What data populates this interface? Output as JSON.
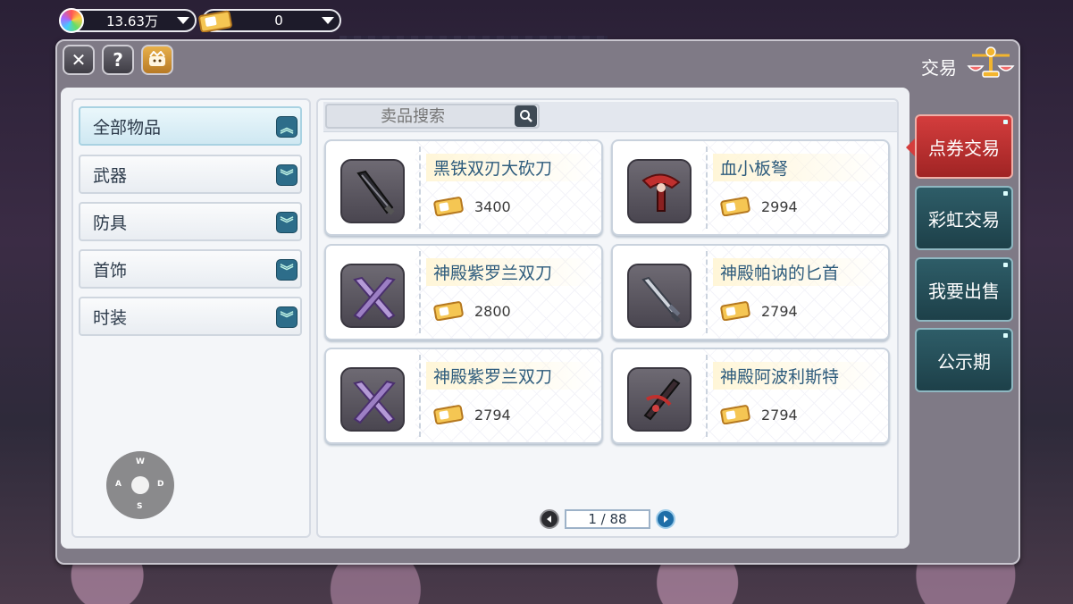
{
  "currency": {
    "rainbow_value": "13.63万",
    "ticket_value": "0"
  },
  "window": {
    "title": "交易"
  },
  "search": {
    "placeholder": "卖品搜索"
  },
  "categories": [
    {
      "label": "全部物品",
      "expanded": true
    },
    {
      "label": "武器",
      "expanded": false
    },
    {
      "label": "防具",
      "expanded": false
    },
    {
      "label": "首饰",
      "expanded": false
    },
    {
      "label": "时装",
      "expanded": false
    }
  ],
  "items": [
    {
      "name": "黑铁双刃大砍刀",
      "price": "3400"
    },
    {
      "name": "血小板弩",
      "price": "2994"
    },
    {
      "name": "神殿紫罗兰双刀",
      "price": "2800"
    },
    {
      "name": "神殿帕讷的匕首",
      "price": "2794"
    },
    {
      "name": "神殿紫罗兰双刀",
      "price": "2794"
    },
    {
      "name": "神殿阿波利斯特",
      "price": "2794"
    }
  ],
  "pager": {
    "current": 1,
    "total": 88,
    "text": "1 / 88"
  },
  "side_tabs": [
    {
      "label": "点券交易",
      "active": true
    },
    {
      "label": "彩虹交易",
      "active": false
    },
    {
      "label": "我要出售",
      "active": false
    },
    {
      "label": "公示期",
      "active": false
    }
  ],
  "dpad": {
    "up": "W",
    "left": "A",
    "right": "D",
    "down": "S"
  },
  "colors": {
    "accent_red": "#d43d3d",
    "tab_teal": "#2e5d68",
    "item_name": "#2d5b7c"
  }
}
